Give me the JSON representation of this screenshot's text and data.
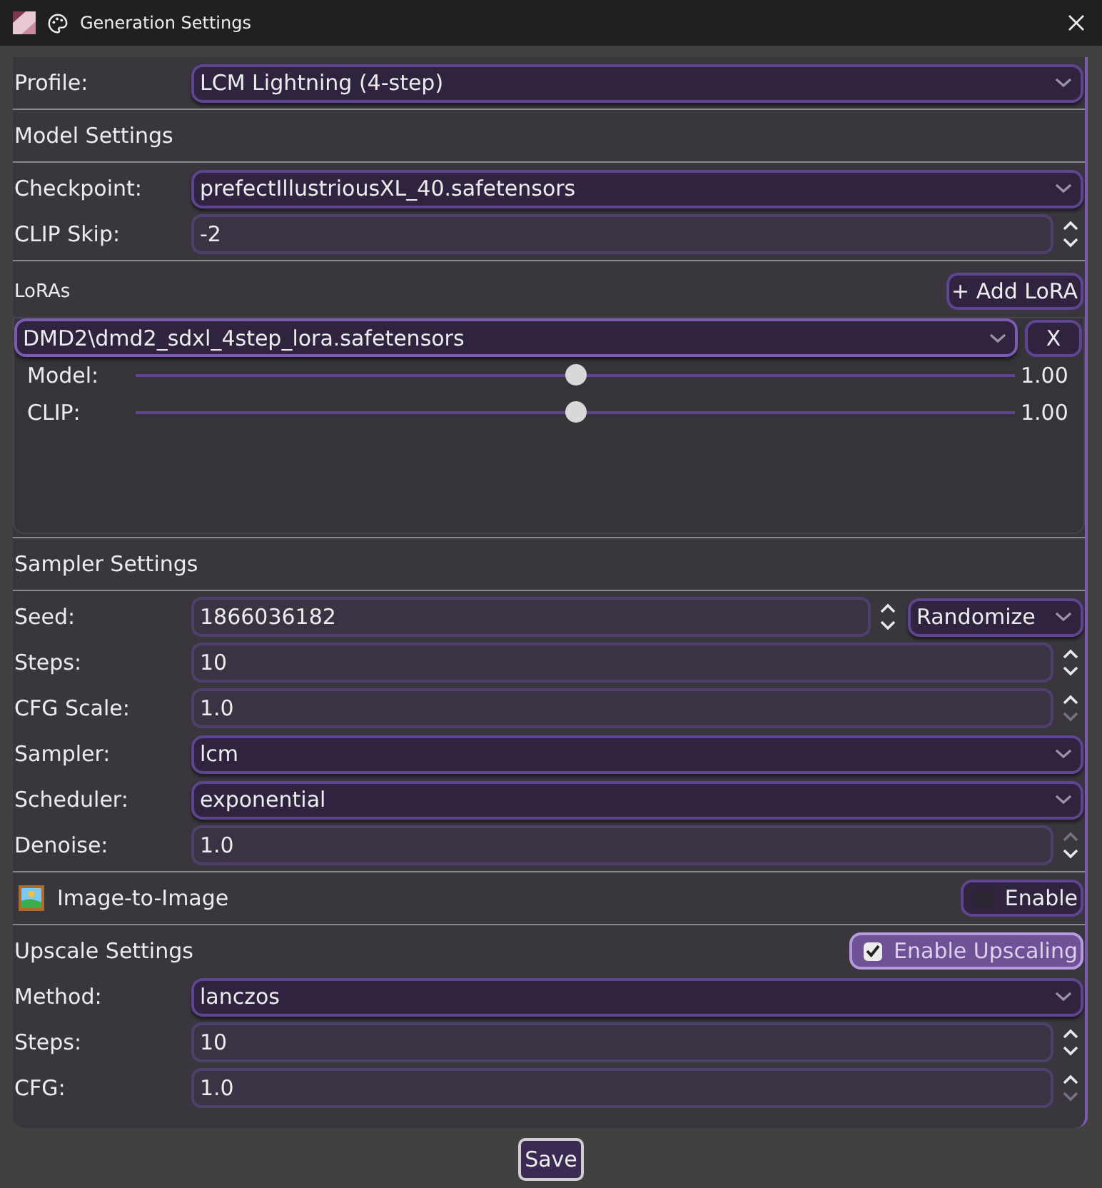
{
  "window": {
    "title": "Generation Settings"
  },
  "sections": [
    [
      {
        "kind": "combo",
        "label": "Profile:",
        "value": "LCM Lightning (4-step)"
      }
    ],
    [
      {
        "kind": "heading",
        "label": "Model Settings"
      }
    ],
    [
      {
        "kind": "combo",
        "label": "Checkpoint:",
        "value": "prefectIllustriousXL_40.safetensors"
      },
      {
        "kind": "spin",
        "label": "CLIP Skip:",
        "value": "-2",
        "up_disabled": false,
        "down_disabled": false
      }
    ],
    [
      {
        "kind": "loras",
        "label": "LoRAs",
        "add_button": "+ Add LoRA",
        "items": [
          {
            "file": "DMD2\\dmd2_sdxl_4step_lora.safetensors",
            "remove": "X",
            "sliders": [
              {
                "label": "Model:",
                "level": 0.5,
                "reading": "1.00"
              },
              {
                "label": "CLIP:",
                "level": 0.5,
                "reading": "1.00"
              }
            ]
          }
        ]
      }
    ],
    [
      {
        "kind": "heading",
        "label": "Sampler Settings"
      }
    ],
    [
      {
        "kind": "seed",
        "label": "Seed:",
        "value": "1866036182",
        "mode": "Randomize"
      },
      {
        "kind": "spin",
        "label": "Steps:",
        "value": "10",
        "up_disabled": false,
        "down_disabled": false
      },
      {
        "kind": "spin",
        "label": "CFG Scale:",
        "value": "1.0",
        "up_disabled": false,
        "down_disabled": true
      },
      {
        "kind": "combo",
        "label": "Sampler:",
        "value": "lcm"
      },
      {
        "kind": "combo",
        "label": "Scheduler:",
        "value": "exponential"
      },
      {
        "kind": "spin",
        "label": "Denoise:",
        "value": "1.0",
        "up_disabled": true,
        "down_disabled": false
      }
    ],
    [
      {
        "kind": "toggle",
        "label": "Image-to-Image",
        "icon": true,
        "toggle": "Enable",
        "checked": false
      }
    ],
    [
      {
        "kind": "toggle",
        "label": "Upscale Settings",
        "icon": false,
        "toggle": "Enable Upscaling",
        "checked": true
      },
      {
        "kind": "combo",
        "label": "Method:",
        "value": "lanczos"
      },
      {
        "kind": "spin",
        "label": "Steps:",
        "value": "10",
        "up_disabled": false,
        "down_disabled": false
      },
      {
        "kind": "spin",
        "label": "CFG:",
        "value": "1.0",
        "up_disabled": false,
        "down_disabled": true
      }
    ]
  ],
  "save_button": "Save"
}
